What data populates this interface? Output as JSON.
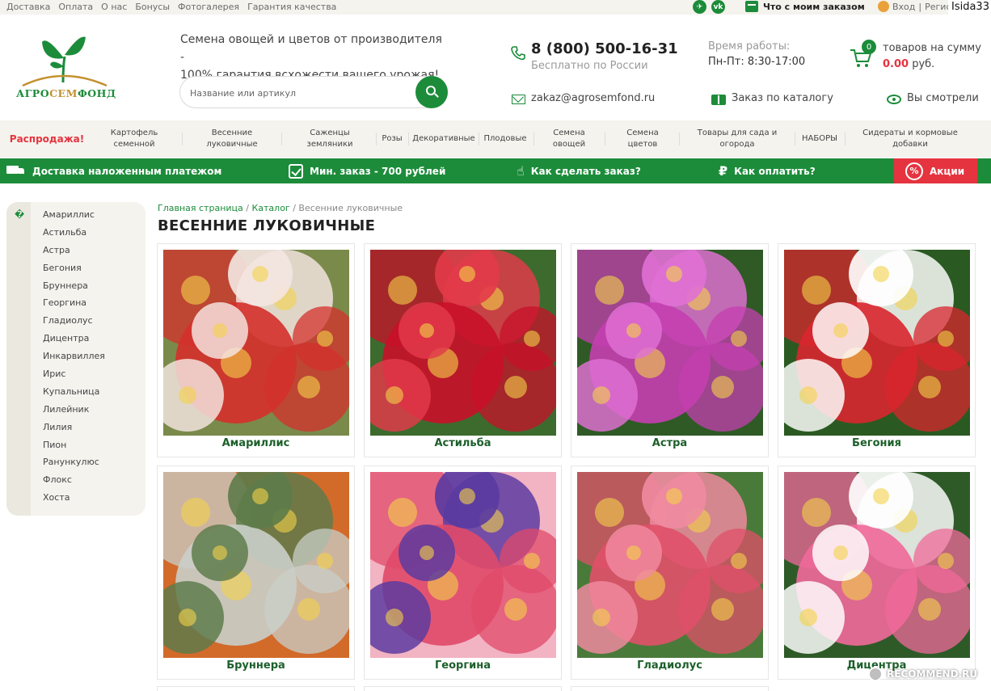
{
  "topbar": {
    "links": [
      "Доставка",
      "Оплата",
      "О нас",
      "Бонусы",
      "Фотогалерея",
      "Гарантия качества"
    ],
    "social": [
      {
        "icon": "telegram-icon",
        "glyph": "✈"
      },
      {
        "icon": "vk-icon",
        "glyph": "vk"
      }
    ],
    "order_status": "Что с моим заказом",
    "login": "Вход",
    "separator": "|",
    "register": "Регист",
    "username": "Isida33"
  },
  "header": {
    "logo_text_left": "АГРО",
    "logo_text_mid": "СЕМ",
    "logo_text_right": "ФОНД",
    "tagline_line1": "Семена овощей и цветов от производителя -",
    "tagline_line2": "100% гарантия всхожести вашего урожая!",
    "search_placeholder": "Название или артикул",
    "phone": "8 (800) 500-16-31",
    "phone_note": "Бесплатно по России",
    "hours_label": "Время работы:",
    "hours": "Пн-Пт: 8:30-17:00",
    "cart_count": "0",
    "cart_text": "товаров на сумму",
    "cart_sum": "0.00",
    "cart_currency": " руб.",
    "email": "zakaz@agrosemfond.ru",
    "catalog_order": "Заказ по каталогу",
    "viewed": "Вы смотрели"
  },
  "menu": {
    "sale": "Распродажа!",
    "items": [
      {
        "l1": "Картофель",
        "l2": "семенной"
      },
      {
        "l1": "Весенние",
        "l2": "луковичные"
      },
      {
        "l1": "Саженцы",
        "l2": "земляники"
      },
      {
        "l1": "Розы",
        "l2": ""
      },
      {
        "l1": "Декоративные",
        "l2": ""
      },
      {
        "l1": "Плодовые",
        "l2": ""
      },
      {
        "l1": "Семена",
        "l2": "овощей"
      },
      {
        "l1": "Семена",
        "l2": "цветов"
      },
      {
        "l1": "Товары для сада и",
        "l2": "огорода"
      },
      {
        "l1": "НАБОРЫ",
        "l2": ""
      },
      {
        "l1": "Сидераты и кормовые",
        "l2": "добавки"
      }
    ]
  },
  "infobar": {
    "delivery": "Доставка наложенным платежом",
    "min_order": "Мин. заказ - 700 рублей",
    "how_order": "Как сделать заказ?",
    "how_pay": "Как оплатить?",
    "promo": "Акции"
  },
  "sidebar": {
    "marker": "�",
    "items": [
      "Амариллис",
      "Астильба",
      "Астра",
      "Бегония",
      "Бруннера",
      "Георгина",
      "Гладиолус",
      "Дицентра",
      "Инкарвиллея",
      "Ирис",
      "Купальница",
      "Лилейник",
      "Лилия",
      "Пион",
      "Ранункулюс",
      "Флокс",
      "Хоста"
    ]
  },
  "breadcrumb": {
    "home": "Главная страница",
    "sep": " / ",
    "catalog": "Каталог",
    "current": "Весенние луковичные"
  },
  "page_title": "ВЕСЕННИЕ ЛУКОВИЧНЫЕ",
  "products": [
    {
      "name": "Амариллис",
      "colors": [
        "#d4302c",
        "#f4e6e2",
        "#7a8a4a"
      ]
    },
    {
      "name": "Астильба",
      "colors": [
        "#c8102a",
        "#e23a4a",
        "#3d6b2e"
      ]
    },
    {
      "name": "Астра",
      "colors": [
        "#c43fb0",
        "#e070d4",
        "#2f5a25"
      ]
    },
    {
      "name": "Бегония",
      "colors": [
        "#d9262e",
        "#ffffff",
        "#2a5a22"
      ]
    },
    {
      "name": "Бруннера",
      "colors": [
        "#c9cfc8",
        "#5d7b4a",
        "#d26a2a"
      ]
    },
    {
      "name": "Георгина",
      "colors": [
        "#e04a6a",
        "#5a3aa0",
        "#f2b3c3"
      ]
    },
    {
      "name": "Гладиолус",
      "colors": [
        "#e0506a",
        "#f08aa0",
        "#4a7a3a"
      ]
    },
    {
      "name": "Дицентра",
      "colors": [
        "#f06a9a",
        "#ffffff",
        "#2e5a28"
      ]
    }
  ],
  "watermark": "RECOMMEND.RU"
}
